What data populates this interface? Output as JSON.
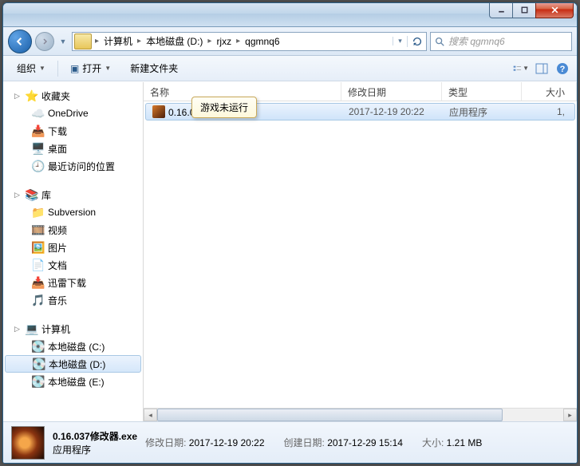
{
  "breadcrumb": {
    "items": [
      "计算机",
      "本地磁盘 (D:)",
      "rjxz",
      "qgmnq6"
    ]
  },
  "search": {
    "placeholder": "搜索 qgmnq6"
  },
  "toolbar": {
    "organize": "组织",
    "open": "打开",
    "newfolder": "新建文件夹"
  },
  "sidebar": {
    "favorites": {
      "label": "收藏夹",
      "items": [
        "OneDrive",
        "下载",
        "桌面",
        "最近访问的位置"
      ]
    },
    "libraries": {
      "label": "库",
      "items": [
        "Subversion",
        "视频",
        "图片",
        "文档",
        "迅雷下载",
        "音乐"
      ]
    },
    "computer": {
      "label": "计算机",
      "items": [
        "本地磁盘 (C:)",
        "本地磁盘 (D:)",
        "本地磁盘 (E:)"
      ]
    }
  },
  "columns": {
    "name": "名称",
    "date": "修改日期",
    "type": "类型",
    "size": "大小"
  },
  "tooltip": "游戏未运行",
  "files": [
    {
      "name": "0.16.037修改器.exe",
      "date": "2017-12-19 20:22",
      "type": "应用程序",
      "size": "1,"
    }
  ],
  "details": {
    "filename": "0.16.037修改器.exe",
    "type": "应用程序",
    "mod_label": "修改日期:",
    "mod_value": "2017-12-19 20:22",
    "create_label": "创建日期:",
    "create_value": "2017-12-29 15:14",
    "size_label": "大小:",
    "size_value": "1.21 MB"
  }
}
